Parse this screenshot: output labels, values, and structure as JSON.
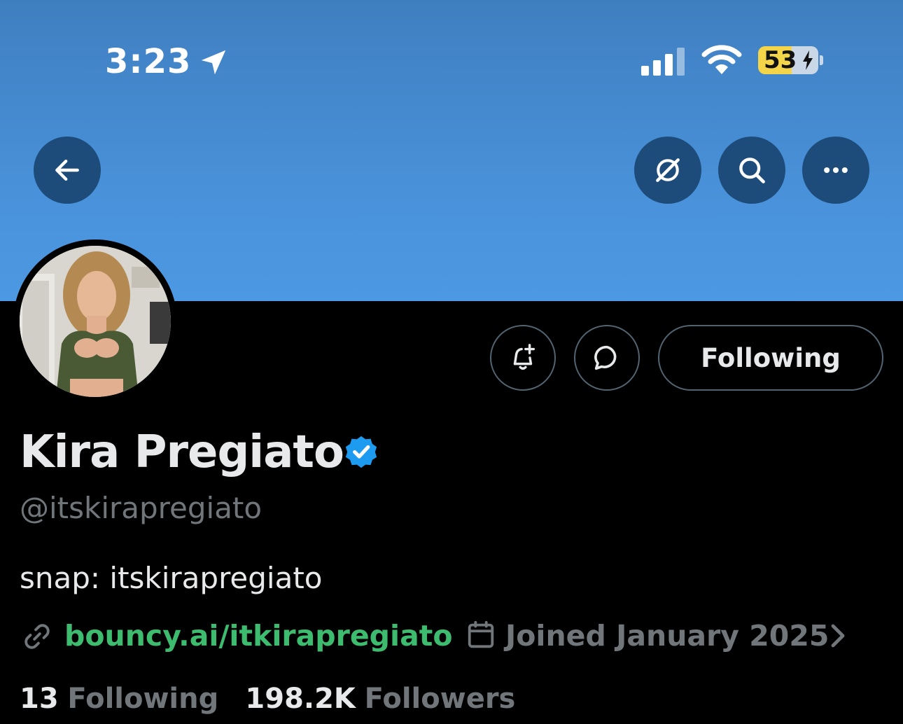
{
  "status_bar": {
    "time": "3:23",
    "battery": "53",
    "icons": [
      "location-arrow-icon",
      "cellular-signal-icon",
      "wifi-icon",
      "battery-charging-icon"
    ]
  },
  "banner": {
    "color": "#4a93dc",
    "buttons": [
      "back-arrow-icon",
      "grok-icon",
      "search-icon",
      "more-icon"
    ]
  },
  "profile": {
    "display_name": "Kira Pregiato",
    "verified": true,
    "handle": "@itskirapregiato",
    "bio": "snap: itskirapregiato",
    "website": "bouncy.ai/itkirapregiato",
    "joined": "Joined January 2025",
    "following_count": "13",
    "following_label": "Following",
    "followers_count": "198.2K",
    "followers_label": "Followers"
  },
  "actions": {
    "following_button": "Following",
    "icons": [
      "bell-plus-icon",
      "message-bubble-icon"
    ]
  },
  "colors": {
    "background": "#000000",
    "link_green": "#3dbb6e",
    "muted_gray": "#71767b",
    "verified_blue": "#1d9bf0"
  }
}
